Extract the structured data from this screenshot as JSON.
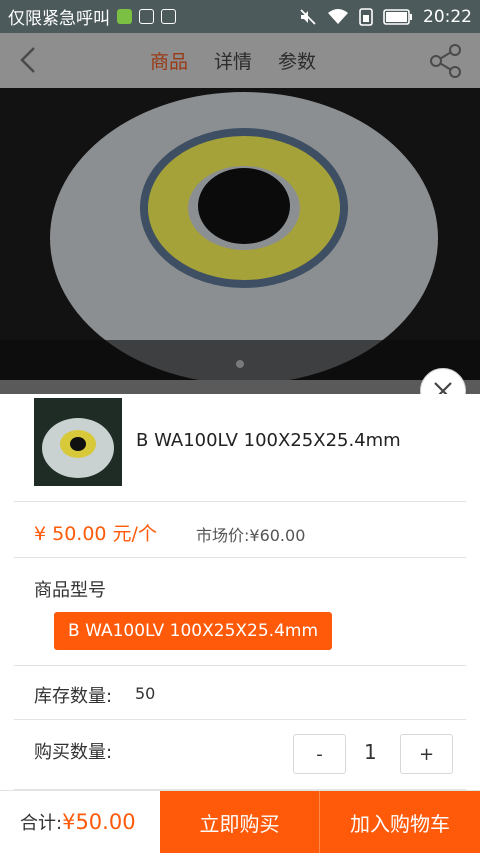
{
  "status_bar": {
    "carrier_text": "仅限紧急呼叫",
    "time": "20:22",
    "icons": [
      "notification-icon",
      "upload-icon",
      "image-icon",
      "mute-icon",
      "wifi-icon",
      "sim-icon",
      "battery-icon"
    ]
  },
  "toolbar": {
    "tabs": [
      {
        "label": "商品",
        "active": true
      },
      {
        "label": "详情",
        "active": false
      },
      {
        "label": "参数",
        "active": false
      }
    ],
    "back_icon": "back-chevron-icon",
    "share_icon": "share-icon"
  },
  "product": {
    "name": "B WA100LV 100X25X25.4mm",
    "price": "¥ 50.00 元/个",
    "market_price": "市场价:¥60.00"
  },
  "model": {
    "title": "商品型号",
    "selected": "B WA100LV 100X25X25.4mm"
  },
  "stock": {
    "label": "库存数量:",
    "value": "50"
  },
  "quantity": {
    "label": "购买数量:",
    "minus": "-",
    "value": "1",
    "plus": "+"
  },
  "bottom": {
    "total_label": "合计:",
    "total_value": "¥50.00",
    "buy_now": "立即购买",
    "add_cart": "加入购物车"
  },
  "colors": {
    "accent": "#ff5a0a",
    "status_bar": "#4c5a5c",
    "dim_overlay": "#8e8e8e"
  }
}
